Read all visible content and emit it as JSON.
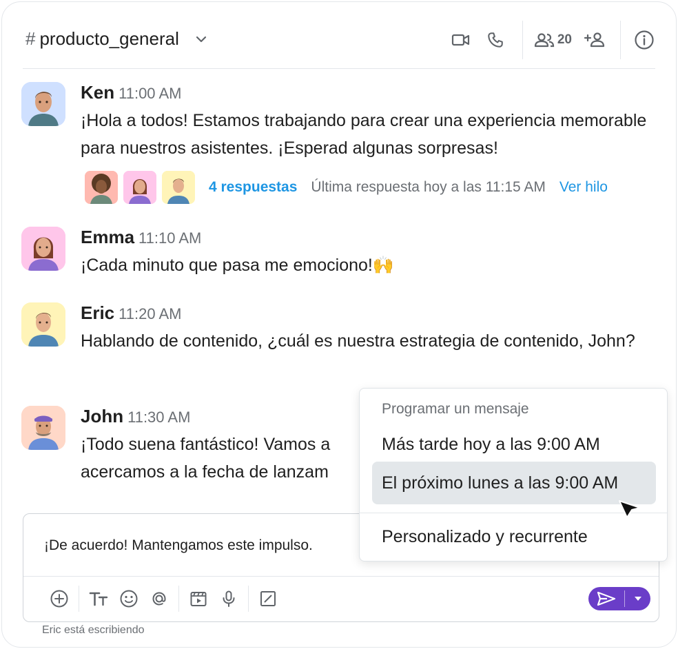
{
  "header": {
    "hash": "#",
    "channel_name": "producto_general",
    "member_count": "20",
    "icons": [
      "chevron-down-icon",
      "video-icon",
      "phone-icon",
      "members-icon",
      "add-member-icon",
      "info-icon"
    ]
  },
  "messages": [
    {
      "author": "Ken",
      "time": "11:00 AM",
      "text": "¡Hola a todos! Estamos trabajando para crear una experiencia memorable para nuestros asistentes. ¡Esperad algunas sorpresas!",
      "avatar_bg": "#cfe0ff",
      "thread": {
        "replies": "4 respuestas",
        "last_reply": "Última respuesta hoy a las 11:15 AM",
        "view": "Ver hilo"
      }
    },
    {
      "author": "Emma",
      "time": "11:10 AM",
      "text": "¡Cada minuto que pasa me emociono!🙌",
      "avatar_bg": "#ffc6ea"
    },
    {
      "author": "Eric",
      "time": "11:20 AM",
      "text": "Hablando de contenido, ¿cuál es nuestra estrategia de contenido, John?",
      "avatar_bg": "#fff4b8"
    },
    {
      "author": "John",
      "time": "11:30 AM",
      "text_line1": "¡Todo suena fantástico! Vamos a",
      "text_line2": "acercamos a la fecha de lanzam",
      "avatar_bg": "#ffd8c8"
    }
  ],
  "composer": {
    "value": "¡De acuerdo! Mantengamos este impulso.",
    "typing_status": "Eric está escribiendo",
    "tools": [
      "add-icon",
      "text-format-icon",
      "emoji-icon",
      "mention-icon",
      "video-clip-icon",
      "microphone-icon",
      "slash-command-icon"
    ],
    "send_color": "#6a3dc8"
  },
  "schedule_menu": {
    "title": "Programar un mensaje",
    "items": [
      "Más tarde hoy a las 9:00 AM",
      "El próximo lunes a las 9:00 AM",
      "Personalizado y recurrente"
    ],
    "selected_index": 1
  },
  "colors": {
    "link": "#1e96e3",
    "muted": "#6b6f74",
    "selected_bg": "#e3e7ea"
  }
}
